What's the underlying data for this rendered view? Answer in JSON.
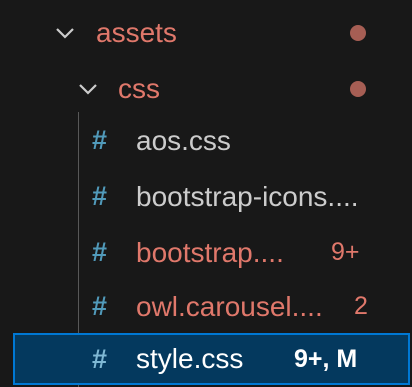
{
  "colors": {
    "background": "#181818",
    "folder_modified": "#e0786b",
    "text_default": "#cccccc",
    "text_selected": "#ffffff",
    "hash_icon": "#519aba",
    "dot": "#a65e54",
    "error_red": "#f14c4c",
    "selection_bg": "#04395e",
    "selection_border": "#0078d4"
  },
  "tree": {
    "folders": [
      {
        "label": "assets",
        "icon": "chevron-down-icon",
        "expanded": true,
        "decoration": "dot"
      },
      {
        "label": "css",
        "icon": "chevron-down-icon",
        "expanded": true,
        "decoration": "dot"
      }
    ],
    "files": [
      {
        "icon": "hash-icon",
        "hash": "#",
        "label": "aos.css",
        "badge": ""
      },
      {
        "icon": "hash-icon",
        "hash": "#",
        "label": "bootstrap-icons....",
        "badge": ""
      },
      {
        "icon": "hash-icon",
        "hash": "#",
        "label": "bootstrap....",
        "badge": "9+"
      },
      {
        "icon": "hash-icon",
        "hash": "#",
        "label": "owl.carousel....",
        "badge": "2"
      },
      {
        "icon": "hash-icon",
        "hash": "#",
        "label": "style.css",
        "badge": "9+, M",
        "selected": true
      }
    ]
  }
}
